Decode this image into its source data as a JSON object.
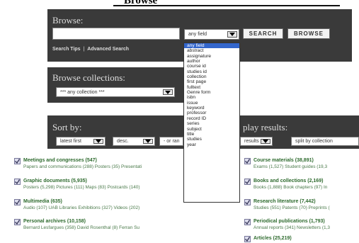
{
  "header": {
    "title": "Browse"
  },
  "browse": {
    "title": "Browse:",
    "search_value": "",
    "field_select": "any field",
    "search_label": "SEARCH",
    "browse_label": "BROWSE",
    "tips_label": "Search Tips",
    "separator": "|",
    "advanced_label": "Advanced Search"
  },
  "dropdown": {
    "options": [
      "any field",
      "abstract",
      "assignature",
      "author",
      "course id",
      "studies id",
      "collection",
      "first page",
      "fulltext",
      "Genre form",
      "isbn",
      "issue",
      "keyword",
      "professor",
      "record ID",
      "series",
      "subject",
      "title",
      "studies",
      "year"
    ],
    "selected": 0
  },
  "collections": {
    "title": "Browse collections:",
    "value": "*** any collection ***"
  },
  "sort": {
    "title": "Sort by:",
    "display_title": "play results:",
    "sort_value": "latest first",
    "order_value": "desc.",
    "rank_value": "- or ran",
    "results_value": "results",
    "split_value": "split by collection"
  },
  "facets_left": [
    {
      "title": "Meetings and congresses (547)",
      "sub": "Papers and communications (288) Posters (35) Presentati"
    },
    {
      "title": "Graphic documents (5,935)",
      "sub": "Posters (5,298) Pictures (111) Maps (83) Postcards (140)"
    },
    {
      "title": "Multimedia (635)",
      "sub": "Audio (107) UAB Libraries Exhibitions (327) Videos (202)"
    },
    {
      "title": "Personal archives (10,158)",
      "sub": "Bernard Lesfargues (358) David Rosenthal (8) Ferran Su"
    }
  ],
  "facets_right": [
    {
      "title": "Course materials (38,891)",
      "sub": "Exams (1,527) Student guides (19,3"
    },
    {
      "title": "Books and collections (2,169)",
      "sub": "Books (1,888) Book chapters (97) In"
    },
    {
      "title": "Research literature (7,442)",
      "sub": "Studies (551) Patents (70) Preprints ("
    },
    {
      "title": "Periodical publications (1,793)",
      "sub": "Annual reports (341) Newsletters (1,3"
    },
    {
      "title": "Articles (25,219)",
      "sub": ""
    }
  ],
  "colors": {
    "panel": "#3a3a3a",
    "facet_title": "#2d6a2d",
    "selected_option": "#3366cc"
  }
}
